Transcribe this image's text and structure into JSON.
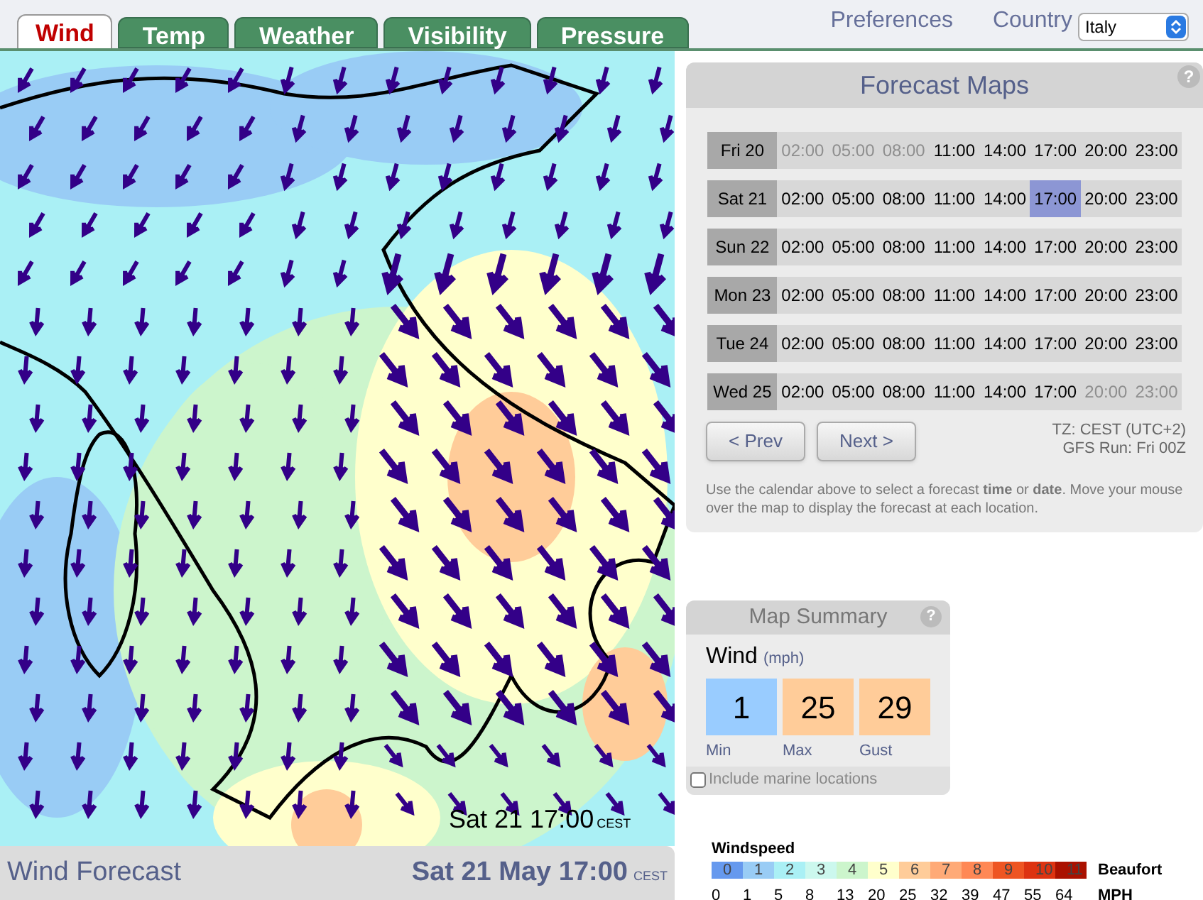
{
  "tabs": [
    {
      "label": "Wind",
      "selected": true
    },
    {
      "label": "Temp",
      "selected": false
    },
    {
      "label": "Weather",
      "selected": false
    },
    {
      "label": "Visibility",
      "selected": false
    },
    {
      "label": "Pressure",
      "selected": false
    }
  ],
  "preferences": "Preferences",
  "country": {
    "label": "Country",
    "value": "Italy"
  },
  "map": {
    "timestamp": "Sat 21 17:00",
    "timezone": "CEST"
  },
  "footer": {
    "title": "Wind Forecast",
    "datetime": "Sat 21 May 17:00",
    "timezone": "CEST"
  },
  "forecast_maps": {
    "title": "Forecast Maps",
    "help": "?",
    "days": [
      {
        "label": "Fri 20",
        "slots": [
          {
            "time": "02:00",
            "disabled": true,
            "selected": false
          },
          {
            "time": "05:00",
            "disabled": true,
            "selected": false
          },
          {
            "time": "08:00",
            "disabled": true,
            "selected": false
          },
          {
            "time": "11:00",
            "disabled": false,
            "selected": false
          },
          {
            "time": "14:00",
            "disabled": false,
            "selected": false
          },
          {
            "time": "17:00",
            "disabled": false,
            "selected": false
          },
          {
            "time": "20:00",
            "disabled": false,
            "selected": false
          },
          {
            "time": "23:00",
            "disabled": false,
            "selected": false
          }
        ]
      },
      {
        "label": "Sat 21",
        "slots": [
          {
            "time": "02:00",
            "disabled": false,
            "selected": false
          },
          {
            "time": "05:00",
            "disabled": false,
            "selected": false
          },
          {
            "time": "08:00",
            "disabled": false,
            "selected": false
          },
          {
            "time": "11:00",
            "disabled": false,
            "selected": false
          },
          {
            "time": "14:00",
            "disabled": false,
            "selected": false
          },
          {
            "time": "17:00",
            "disabled": false,
            "selected": true
          },
          {
            "time": "20:00",
            "disabled": false,
            "selected": false
          },
          {
            "time": "23:00",
            "disabled": false,
            "selected": false
          }
        ]
      },
      {
        "label": "Sun 22",
        "slots": [
          {
            "time": "02:00",
            "disabled": false,
            "selected": false
          },
          {
            "time": "05:00",
            "disabled": false,
            "selected": false
          },
          {
            "time": "08:00",
            "disabled": false,
            "selected": false
          },
          {
            "time": "11:00",
            "disabled": false,
            "selected": false
          },
          {
            "time": "14:00",
            "disabled": false,
            "selected": false
          },
          {
            "time": "17:00",
            "disabled": false,
            "selected": false
          },
          {
            "time": "20:00",
            "disabled": false,
            "selected": false
          },
          {
            "time": "23:00",
            "disabled": false,
            "selected": false
          }
        ]
      },
      {
        "label": "Mon 23",
        "slots": [
          {
            "time": "02:00",
            "disabled": false,
            "selected": false
          },
          {
            "time": "05:00",
            "disabled": false,
            "selected": false
          },
          {
            "time": "08:00",
            "disabled": false,
            "selected": false
          },
          {
            "time": "11:00",
            "disabled": false,
            "selected": false
          },
          {
            "time": "14:00",
            "disabled": false,
            "selected": false
          },
          {
            "time": "17:00",
            "disabled": false,
            "selected": false
          },
          {
            "time": "20:00",
            "disabled": false,
            "selected": false
          },
          {
            "time": "23:00",
            "disabled": false,
            "selected": false
          }
        ]
      },
      {
        "label": "Tue 24",
        "slots": [
          {
            "time": "02:00",
            "disabled": false,
            "selected": false
          },
          {
            "time": "05:00",
            "disabled": false,
            "selected": false
          },
          {
            "time": "08:00",
            "disabled": false,
            "selected": false
          },
          {
            "time": "11:00",
            "disabled": false,
            "selected": false
          },
          {
            "time": "14:00",
            "disabled": false,
            "selected": false
          },
          {
            "time": "17:00",
            "disabled": false,
            "selected": false
          },
          {
            "time": "20:00",
            "disabled": false,
            "selected": false
          },
          {
            "time": "23:00",
            "disabled": false,
            "selected": false
          }
        ]
      },
      {
        "label": "Wed 25",
        "slots": [
          {
            "time": "02:00",
            "disabled": false,
            "selected": false
          },
          {
            "time": "05:00",
            "disabled": false,
            "selected": false
          },
          {
            "time": "08:00",
            "disabled": false,
            "selected": false
          },
          {
            "time": "11:00",
            "disabled": false,
            "selected": false
          },
          {
            "time": "14:00",
            "disabled": false,
            "selected": false
          },
          {
            "time": "17:00",
            "disabled": false,
            "selected": false
          },
          {
            "time": "20:00",
            "disabled": true,
            "selected": false
          },
          {
            "time": "23:00",
            "disabled": true,
            "selected": false
          }
        ]
      }
    ],
    "prev": "< Prev",
    "next": "Next >",
    "tz": "TZ: CEST (UTC+2)",
    "run": "GFS Run: Fri 00Z",
    "help_text": "Use the calendar above to select a forecast **time** or **date**. Move your mouse over the map to display the forecast at each location."
  },
  "summary": {
    "title": "Map Summary",
    "help": "?",
    "heading": "Wind",
    "unit": "(mph)",
    "stats": [
      {
        "value": "1",
        "label": "Min",
        "color": "#99ccff"
      },
      {
        "value": "25",
        "label": "Max",
        "color": "#ffcc99"
      },
      {
        "value": "29",
        "label": "Gust",
        "color": "#ffcc99"
      }
    ],
    "marine": {
      "label": "Include marine locations",
      "checked": false
    }
  },
  "legend": {
    "title": "Windspeed",
    "scale_label": "Beaufort",
    "unit_label": "MPH",
    "bands": [
      {
        "label": "0",
        "color": "#6699ee"
      },
      {
        "label": "1",
        "color": "#99ccf5"
      },
      {
        "label": "2",
        "color": "#aaf0f5"
      },
      {
        "label": "3",
        "color": "#ccf8ee"
      },
      {
        "label": "4",
        "color": "#ccf5cc"
      },
      {
        "label": "5",
        "color": "#ffffcc"
      },
      {
        "label": "6",
        "color": "#ffcc99"
      },
      {
        "label": "7",
        "color": "#ffaa77"
      },
      {
        "label": "8",
        "color": "#ff8855"
      },
      {
        "label": "9",
        "color": "#ee5522"
      },
      {
        "label": "10",
        "color": "#dd3311"
      },
      {
        "label": "11",
        "color": "#aa1100"
      }
    ],
    "speeds": [
      "0",
      "1",
      "5",
      "8",
      "13",
      "20",
      "25",
      "32",
      "39",
      "47",
      "55",
      "64"
    ]
  }
}
